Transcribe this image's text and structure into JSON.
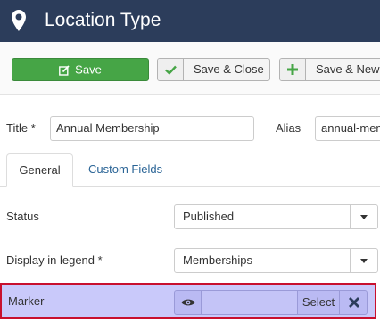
{
  "header": {
    "title": "Location Type",
    "icon": "map-pin-icon"
  },
  "toolbar": {
    "save_label": "Save",
    "save_close_label": "Save & Close",
    "save_new_label": "Save & New"
  },
  "form": {
    "title_label": "Title *",
    "title_value": "Annual Membership",
    "alias_label": "Alias",
    "alias_value": "annual-membership"
  },
  "tabs": [
    {
      "label": "General",
      "active": true
    },
    {
      "label": "Custom Fields",
      "active": false
    }
  ],
  "fields": {
    "status_label": "Status",
    "status_value": "Published",
    "legend_label": "Display in legend *",
    "legend_value": "Memberships",
    "marker_label": "Marker",
    "marker_value": "",
    "marker_select_label": "Select"
  },
  "colors": {
    "header_bg": "#2c3d5b",
    "save_green": "#46a546",
    "tab_link": "#2a6496",
    "highlight_border": "#c8102e",
    "highlight_bg": "#c9c9fa"
  }
}
